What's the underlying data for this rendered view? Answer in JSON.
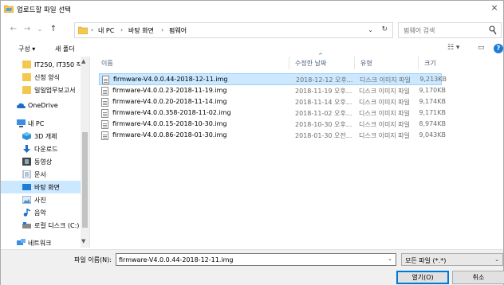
{
  "window": {
    "title": "업로드할 파일 선택",
    "close_glyph": "×"
  },
  "address": {
    "crumbs": [
      "내 PC",
      "바탕 화면",
      "펌웨어"
    ],
    "separator": "›",
    "lead_separator": "›",
    "dropdown_glyph": "⌄",
    "refresh_glyph": "↻",
    "search_placeholder": "펌웨어 검색"
  },
  "nav_buttons": {
    "back": "←",
    "forward": "→",
    "recent": "⌄",
    "up": "↑"
  },
  "toolbar": {
    "organize": "구성 ▾",
    "new_folder": "새 폴더",
    "view_glyph": "☷ ▾",
    "pane_glyph": "▭",
    "help": "?"
  },
  "sidebar": {
    "items": [
      {
        "label": "IT250, IT350 작",
        "icon": "folder-icon"
      },
      {
        "label": "신청 양식",
        "icon": "folder-icon"
      },
      {
        "label": "일일업무보고서",
        "icon": "folder-icon"
      },
      {
        "label": "OneDrive",
        "icon": "cloud-icon"
      },
      {
        "label": "내 PC",
        "icon": "computer-icon"
      },
      {
        "label": "3D 개체",
        "icon": "cube-icon"
      },
      {
        "label": "다운로드",
        "icon": "download-icon"
      },
      {
        "label": "동영상",
        "icon": "video-icon"
      },
      {
        "label": "문서",
        "icon": "document-icon"
      },
      {
        "label": "바탕 화면",
        "icon": "desktop-icon"
      },
      {
        "label": "사진",
        "icon": "pictures-icon"
      },
      {
        "label": "음악",
        "icon": "music-icon"
      },
      {
        "label": "로컬 디스크 (C:)",
        "icon": "drive-icon"
      },
      {
        "label": "네트워크",
        "icon": "network-icon"
      }
    ],
    "selected": "바탕 화면",
    "scroll_up": "▲",
    "scroll_down": "▼"
  },
  "columns": {
    "name": "이름",
    "date": "수정한 날짜",
    "type": "유형",
    "size": "크기",
    "sort_glyph": "^"
  },
  "files": [
    {
      "name": "firmware-V4.0.0.44-2018-12-11.img",
      "date": "2018-12-12 오후...",
      "type": "디스크 이미지 파일",
      "size": "9,213KB",
      "selected": true
    },
    {
      "name": "firmware-V4.0.0.23-2018-11-19.img",
      "date": "2018-11-19 오후...",
      "type": "디스크 이미지 파일",
      "size": "9,170KB",
      "selected": false
    },
    {
      "name": "firmware-V4.0.0.20-2018-11-14.img",
      "date": "2018-11-14 오후...",
      "type": "디스크 이미지 파일",
      "size": "9,174KB",
      "selected": false
    },
    {
      "name": "firmware-V4.0.0.358-2018-11-02.img",
      "date": "2018-11-02 오후...",
      "type": "디스크 이미지 파일",
      "size": "9,171KB",
      "selected": false
    },
    {
      "name": "firmware-V4.0.0.15-2018-10-30.img",
      "date": "2018-10-30 오후...",
      "type": "디스크 이미지 파일",
      "size": "8,974KB",
      "selected": false
    },
    {
      "name": "firmware-V4.0.0.86-2018-01-30.img",
      "date": "2018-01-30 오전...",
      "type": "디스크 이미지 파일",
      "size": "9,043KB",
      "selected": false
    }
  ],
  "footer": {
    "filename_label": "파일 이름(N):",
    "filename_value": "firmware-V4.0.0.44-2018-12-11.img",
    "filename_drop": "⌄",
    "filetype_value": "모든 파일 (*.*)",
    "filetype_drop": "⌄",
    "open_label": "열기(O)",
    "cancel_label": "취소"
  },
  "colors": {
    "accent": "#0078d7",
    "selection": "#cce8ff",
    "folder": "#f4c74f"
  }
}
